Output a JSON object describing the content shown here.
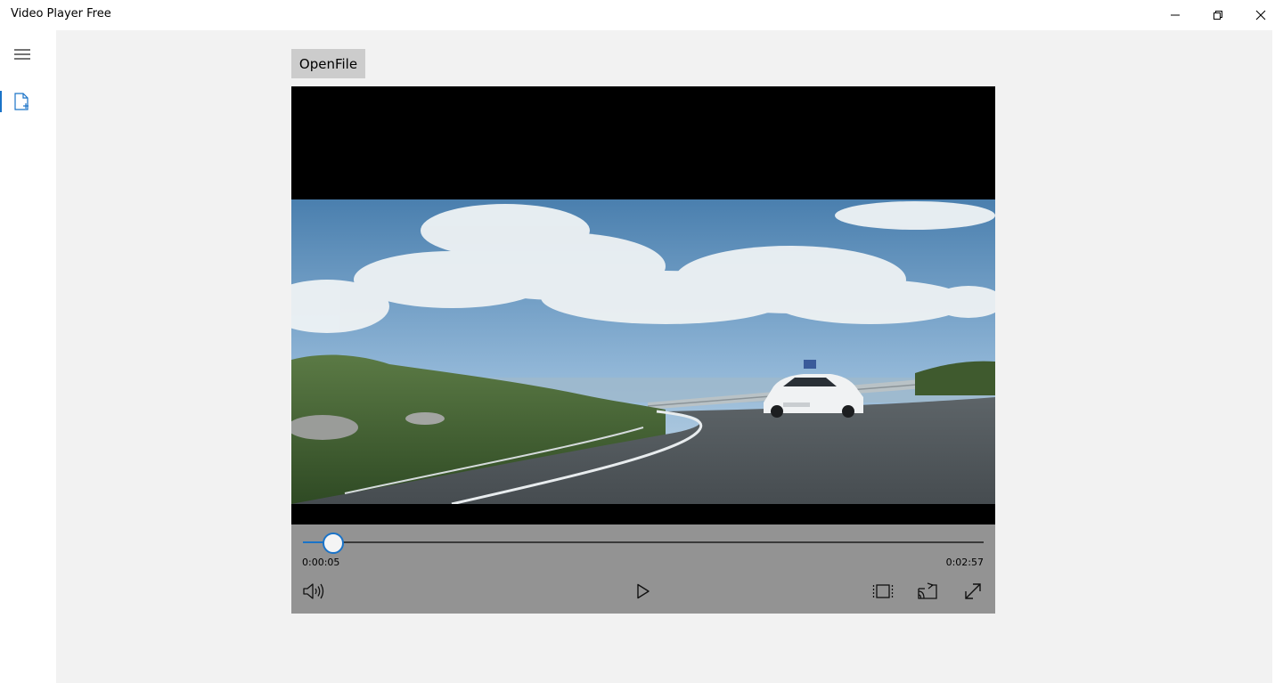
{
  "window": {
    "title": "Video Player Free",
    "controls": {
      "minimize_icon": "minimize-icon",
      "maximize_icon": "restore-icon",
      "close_icon": "close-icon"
    }
  },
  "sidebar": {
    "menu_icon": "hamburger-icon",
    "items": [
      {
        "icon": "open-file-icon",
        "selected": true
      }
    ],
    "accent": "#1a73c8"
  },
  "toolbar": {
    "open_label": "OpenFile"
  },
  "player": {
    "elapsed": "0:00:05",
    "total": "0:02:57",
    "progress": 0.0445,
    "buttons": {
      "volume": "volume-icon",
      "play": "play-icon",
      "aspect": "aspect-ratio-icon",
      "cast": "cast-icon",
      "fullscreen": "fullscreen-icon"
    }
  },
  "colors": {
    "accent": "#1a73c8",
    "content_bg": "#f2f2f2",
    "controls_bg": "#939393",
    "button_bg": "#cccccc"
  }
}
